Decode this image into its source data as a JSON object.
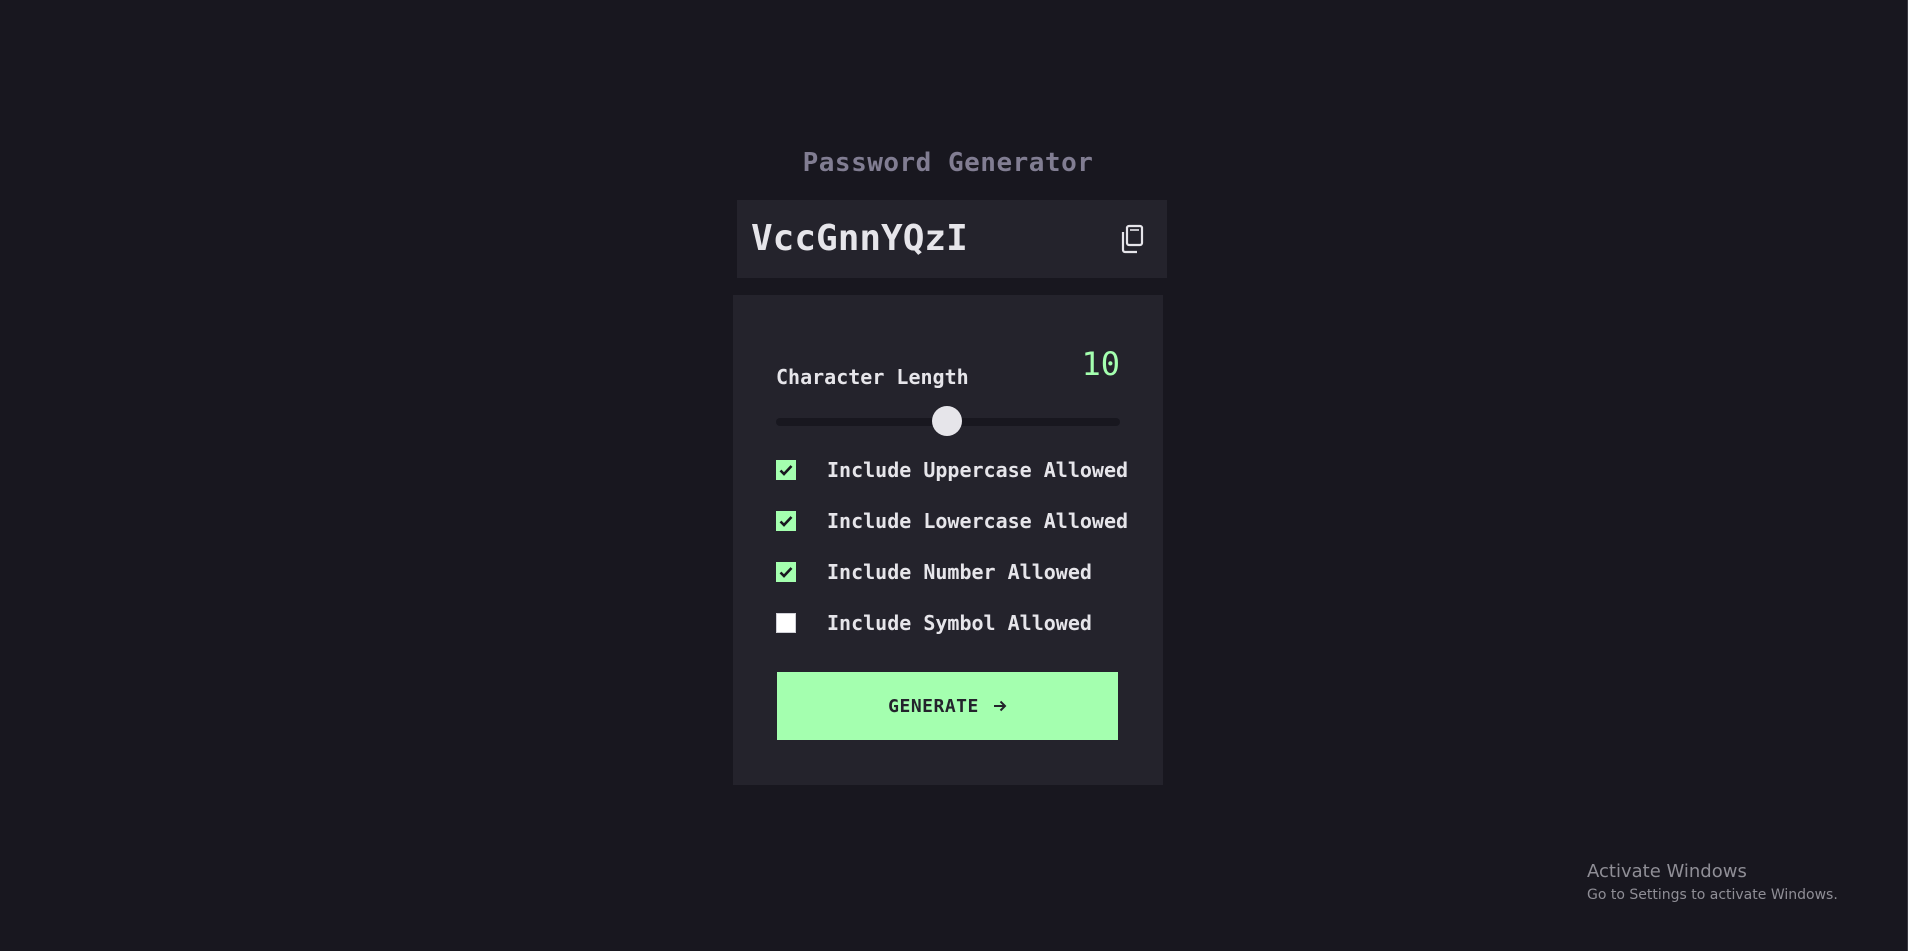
{
  "app": {
    "title": "Password Generator"
  },
  "password": {
    "value": "VccGnnYQzI",
    "copy_icon": "copy-icon"
  },
  "length": {
    "label": "Character Length",
    "value": "10",
    "slider_fraction": 0.5
  },
  "options": [
    {
      "label": "Include Uppercase Allowed",
      "checked": true
    },
    {
      "label": "Include Lowercase Allowed",
      "checked": true
    },
    {
      "label": "Include Number Allowed",
      "checked": true
    },
    {
      "label": "Include Symbol Allowed",
      "checked": false
    }
  ],
  "generate": {
    "label": "GENERATE",
    "icon": "arrow-right-icon"
  },
  "watermark": {
    "title": "Activate Windows",
    "subtitle": "Go to Settings to activate Windows."
  },
  "colors": {
    "background": "#18171f",
    "panel": "#24232c",
    "accent": "#a4ffaf",
    "text": "#e6e5ea",
    "muted": "#817d92"
  }
}
